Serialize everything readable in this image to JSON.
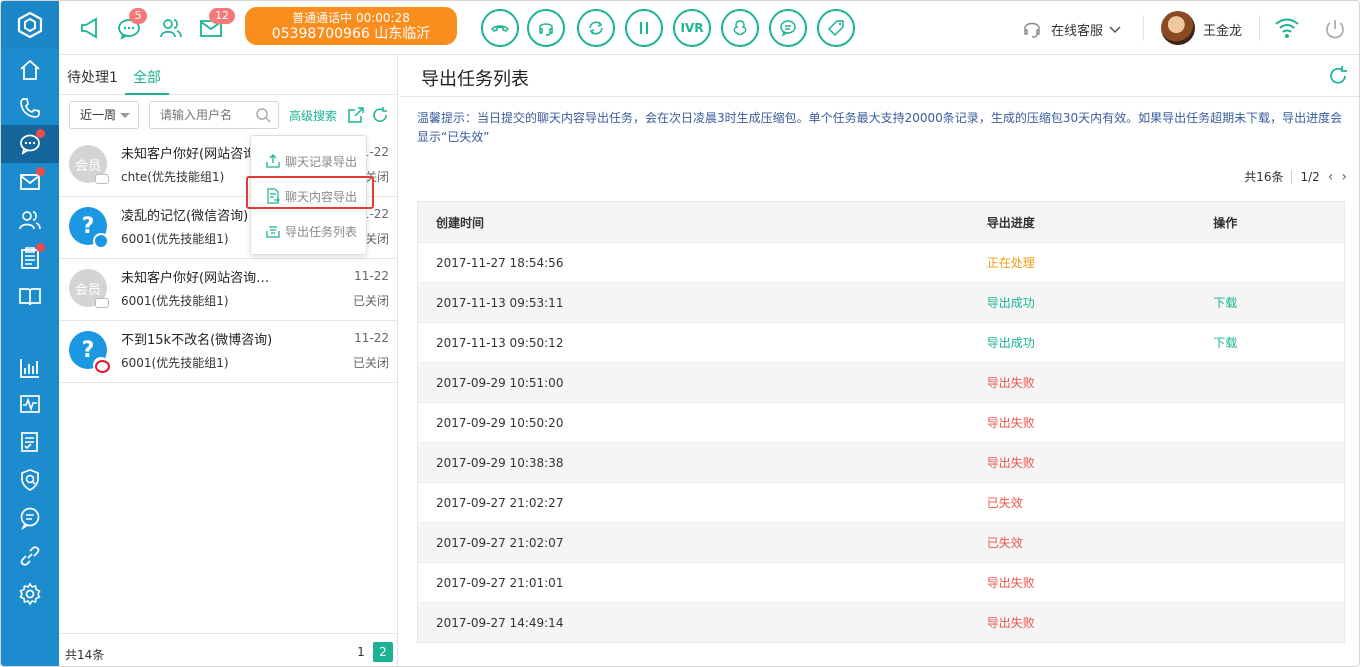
{
  "topbar": {
    "badges": {
      "chat": "5",
      "mail": "12"
    },
    "call_status": {
      "line1": "普通通话中  00:00:28",
      "line2": "05398700966 山东临沂"
    },
    "controls": {
      "ivr": "IVR"
    },
    "agent_state": "在线客服",
    "username": "王金龙"
  },
  "conv": {
    "tabs": {
      "pending": "待处理1",
      "all": "全部"
    },
    "filter": "近一周",
    "search_placeholder": "请输入用户名",
    "advanced": "高级搜索",
    "items": [
      {
        "avatar": "会员",
        "title": "未知客户你好(网站咨询…",
        "group": "chte(优先技能组1)",
        "date": "11-22",
        "state": "已关闭"
      },
      {
        "avatar": "?",
        "title": "凌乱的记忆(微信咨询)",
        "group": "6001(优先技能组1)",
        "date": "11-22",
        "state": "已关闭"
      },
      {
        "avatar": "会员",
        "title": "未知客户你好(网站咨询…",
        "group": "6001(优先技能组1)",
        "date": "11-22",
        "state": "已关闭"
      },
      {
        "avatar": "?",
        "title": "不到15k不改名(微博咨询)",
        "group": "6001(优先技能组1)",
        "date": "11-22",
        "state": "已关闭"
      }
    ],
    "total": "共14条",
    "pages": [
      "1",
      "2"
    ]
  },
  "menu": {
    "items": [
      "聊天记录导出",
      "聊天内容导出",
      "导出任务列表"
    ]
  },
  "main": {
    "title": "导出任务列表",
    "notice": "温馨提示：当日提交的聊天内容导出任务，会在次日凌晨3时生成压缩包。单个任务最大支持20000条记录，生成的压缩包30天内有效。如果导出任务超期未下载，导出进度会显示“已失效”",
    "pager": {
      "total": "共16条",
      "page": "1/2"
    },
    "columns": [
      "创建时间",
      "导出进度",
      "操作"
    ],
    "rows": [
      {
        "time": "2017-11-27 18:54:56",
        "status": "正在处理",
        "action": ""
      },
      {
        "time": "2017-11-13 09:53:11",
        "status": "导出成功",
        "action": "下载"
      },
      {
        "time": "2017-11-13 09:50:12",
        "status": "导出成功",
        "action": "下载"
      },
      {
        "time": "2017-09-29 10:51:00",
        "status": "导出失败",
        "action": ""
      },
      {
        "time": "2017-09-29 10:50:20",
        "status": "导出失败",
        "action": ""
      },
      {
        "time": "2017-09-29 10:38:38",
        "status": "导出失败",
        "action": ""
      },
      {
        "time": "2017-09-27 21:02:27",
        "status": "已失效",
        "action": ""
      },
      {
        "time": "2017-09-27 21:02:07",
        "status": "已失效",
        "action": ""
      },
      {
        "time": "2017-09-27 21:01:01",
        "status": "导出失败",
        "action": ""
      },
      {
        "time": "2017-09-27 14:49:14",
        "status": "导出失败",
        "action": ""
      }
    ]
  },
  "colors": {
    "nav_bg": "#1c8ccf",
    "accent": "#1ab394",
    "call_orange": "#f98e1e",
    "processing": "#f39c12",
    "failed": "#f0554b"
  }
}
